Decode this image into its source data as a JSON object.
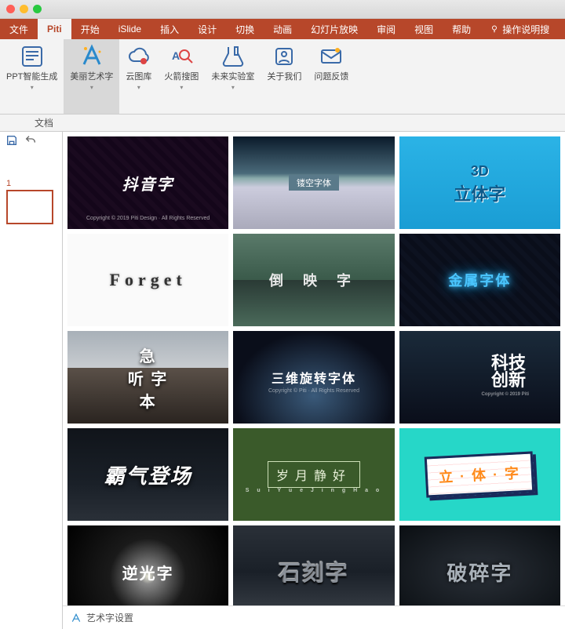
{
  "titlebar": {},
  "tabs": {
    "items": [
      {
        "label": "文件"
      },
      {
        "label": "Piti"
      },
      {
        "label": "开始"
      },
      {
        "label": "iSlide"
      },
      {
        "label": "插入"
      },
      {
        "label": "设计"
      },
      {
        "label": "切换"
      },
      {
        "label": "动画"
      },
      {
        "label": "幻灯片放映"
      },
      {
        "label": "审阅"
      },
      {
        "label": "视图"
      },
      {
        "label": "帮助"
      }
    ],
    "tell_me": "操作说明搜"
  },
  "ribbon": {
    "items": [
      {
        "label": "PPT智能生成"
      },
      {
        "label": "美丽艺术字"
      },
      {
        "label": "云图库"
      },
      {
        "label": "火箭搜图"
      },
      {
        "label": "未来实验室"
      },
      {
        "label": "关于我们"
      },
      {
        "label": "问题反馈"
      }
    ]
  },
  "doc_label": "文档",
  "thumb": {
    "num": "1"
  },
  "gallery": {
    "cards": [
      {
        "label": "抖音字",
        "sub": "Copyright © 2019 Piti Design · All Rights Reserved"
      },
      {
        "label": "镂空字体"
      },
      {
        "l1": "3D",
        "l2": "立体字"
      },
      {
        "label": "Forget"
      },
      {
        "label": "倒 映 字"
      },
      {
        "label": "金属字体"
      },
      {
        "label": "急\n听 字\n   本"
      },
      {
        "label": "三维旋转字体",
        "sub": "Copyright © Piti · All Rights Reserved"
      },
      {
        "label": "科技\n创新",
        "sub": "Copyright © 2019 Piti"
      },
      {
        "label": "霸气登场"
      },
      {
        "label": "岁月静好",
        "sub": "S u i  Y u e  J i n g  H a o"
      },
      {
        "label": "立 · 体 · 字"
      },
      {
        "label": "逆光字"
      },
      {
        "label": "石刻字"
      },
      {
        "label": "破碎字"
      }
    ],
    "footer": "艺术字设置"
  }
}
